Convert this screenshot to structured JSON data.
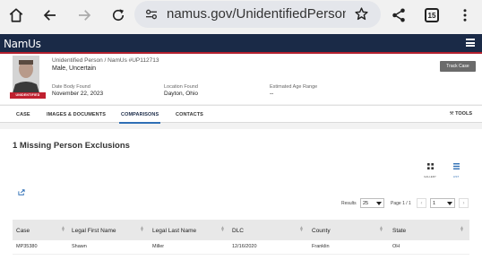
{
  "browser": {
    "url": "namus.gov/UnidentifiedPersons/C",
    "tab_count": "15"
  },
  "site": {
    "logo": "NamUs"
  },
  "case": {
    "id_line": "Unidentified Person / NamUs #UP112713",
    "name": "Male, Uncertain",
    "badge": "UNIDENTIFIED",
    "track_button": "Track Case",
    "date_found_label": "Date Body Found",
    "date_found": "November 22, 2023",
    "location_label": "Location Found",
    "location": "Dayton, Ohio",
    "age_label": "Estimated Age Range",
    "age": "--"
  },
  "tabs": {
    "case": "CASE",
    "images": "IMAGES & DOCUMENTS",
    "comparisons": "COMPARISONS",
    "contacts": "CONTACTS",
    "tools": "TOOLS"
  },
  "main": {
    "title": "1 Missing Person Exclusions",
    "gallery_label": "GALLERY",
    "list_label": "LIST",
    "results_label": "Results",
    "results_value": "25",
    "page_label": "Page 1 / 1",
    "page_value": "1",
    "prev": "‹",
    "next": "›"
  },
  "table": {
    "headers": [
      "Case",
      "Legal First Name",
      "Legal Last Name",
      "DLC",
      "County",
      "State"
    ],
    "rows": [
      [
        "MP35380",
        "Shawn",
        "Miller",
        "12/16/2020",
        "Franklin",
        "OH"
      ]
    ]
  },
  "colors": {
    "nav_bg": "#1a2a47",
    "accent_red": "#b3202e",
    "tab_active_underline": "#2f6fb5"
  }
}
